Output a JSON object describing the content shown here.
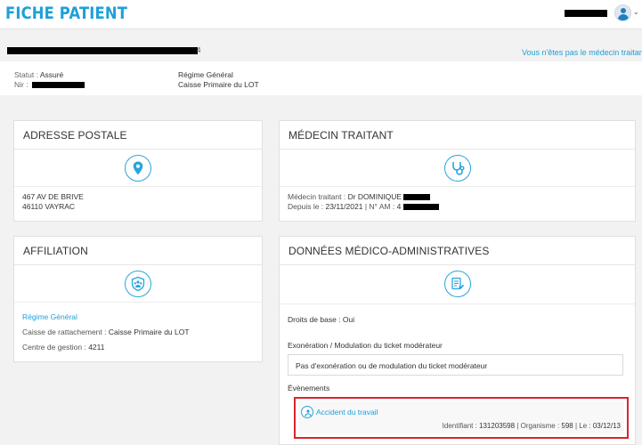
{
  "header": {
    "title": "FICHE PATIENT",
    "user_icon": "user-avatar-icon"
  },
  "patient": {
    "name_tail": "4",
    "not_doctor_link": "Vous n'êtes pas le médecin traitant",
    "status_label": "Statut : ",
    "status_value": "Assuré",
    "nir_label": "Nir : ",
    "regime": "Régime Général",
    "caisse": "Caisse Primaire du LOT"
  },
  "address": {
    "title": "ADRESSE POSTALE",
    "icon": "location-pin-icon",
    "line1": "467 AV DE BRIVE",
    "line2": "46110 VAYRAC"
  },
  "doctor": {
    "title": "MÉDECIN TRAITANT",
    "icon": "stethoscope-icon",
    "doctor_label": "Médecin traitant : ",
    "doctor_name": "Dr DOMINIQUE",
    "since_label": "Depuis le : ",
    "since_value": "23/11/2021",
    "am_label": " | N° AM : ",
    "am_value": "4"
  },
  "affiliation": {
    "title": "AFFILIATION",
    "icon": "group-shield-icon",
    "regime_link": "Régime Général",
    "caisse_label": "Caisse de rattachement : ",
    "caisse_value": "Caisse Primaire du LOT",
    "centre_label": "Centre de gestion : ",
    "centre_value": "4211"
  },
  "medadmin": {
    "title": "DONNÉES MÉDICO-ADMINISTRATIVES",
    "icon": "document-check-icon",
    "rights_label": "Droits de base : ",
    "rights_value": "Oui",
    "exon_label": "Exonération / Modulation du ticket modérateur",
    "exon_value": "Pas d'exonération ou de modulation du ticket modérateur",
    "events_label": "Évènements",
    "event": {
      "icon": "accident-person-icon",
      "label": "Accident du travail",
      "id_label": "Identifiant : ",
      "id_value": "131203598",
      "org_label": " | Organisme : ",
      "org_value": "598",
      "date_label": " | Le : ",
      "date_value": "03/12/13"
    }
  },
  "colors": {
    "accent": "#1ea0d8",
    "highlight_border": "#d9262c",
    "background": "#f2f2f2"
  }
}
